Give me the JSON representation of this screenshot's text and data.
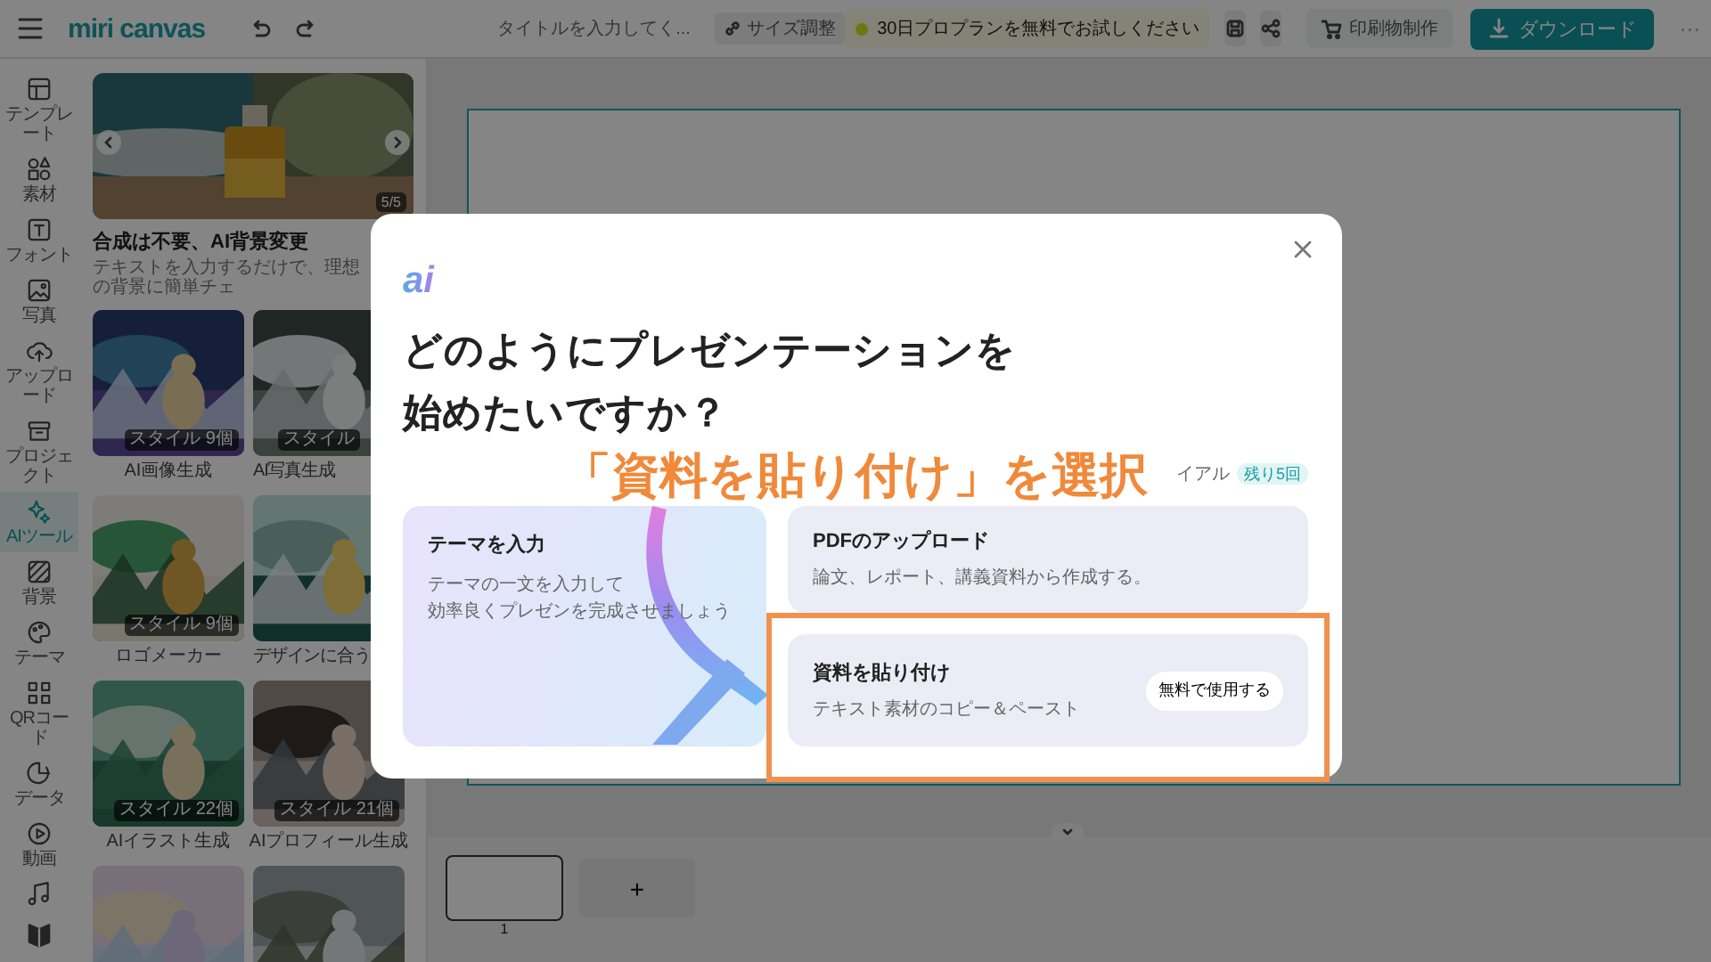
{
  "topbar": {
    "logo": "miri canvas",
    "title_placeholder": "タイトルを入力してく...",
    "resize_button": "サイズ調整",
    "promo": "30日プロプランを無料でお試しください",
    "print_button": "印刷物制作",
    "download_button": "ダウンロード",
    "more": "···"
  },
  "rail": [
    {
      "label": "テンプレート",
      "selected": false
    },
    {
      "label": "素材",
      "selected": false
    },
    {
      "label": "フォント",
      "selected": false
    },
    {
      "label": "写真",
      "selected": false
    },
    {
      "label": "アップロード",
      "selected": false
    },
    {
      "label": "プロジェクト",
      "selected": false
    },
    {
      "label": "AIツール",
      "selected": true
    },
    {
      "label": "背景",
      "selected": false
    },
    {
      "label": "テーマ",
      "selected": false
    },
    {
      "label": "QRコード",
      "selected": false
    },
    {
      "label": "データ",
      "selected": false
    },
    {
      "label": "動画",
      "selected": false
    },
    {
      "selected": false
    },
    {
      "selected": false
    }
  ],
  "panel": {
    "banner": {
      "counter": "5/5",
      "title": "合成は不要、AI背景変更",
      "subtitle": "テキストを入力するだけで、理想の背景に簡単チェ"
    },
    "tiles": [
      {
        "kind": "picture",
        "label": "AI画像生成",
        "badge": "スタイル 9個"
      },
      {
        "kind": "picture",
        "label": "AI写真生成",
        "badge": "スタイル"
      },
      {
        "kind": "picture",
        "label": "ロゴメーカー",
        "badge": "スタイル 9個"
      },
      {
        "kind": "picture",
        "label": "デザインに合う"
      },
      {
        "kind": "picture",
        "label": "AIイラスト生成",
        "badge": "スタイル 22個"
      },
      {
        "kind": "picture",
        "label": "AIプロフィール生成",
        "badge": "スタイル 21個"
      },
      {
        "kind": "picture"
      },
      {
        "kind": "picture"
      }
    ]
  },
  "workspace": {
    "page_number": "1",
    "add_page": "+"
  },
  "modal": {
    "logo": "ai",
    "heading": [
      "どのようにプレゼンテーションを",
      "始めたいですか？"
    ],
    "trial_text": "イアル",
    "trial_badge": "残り5回",
    "options": [
      {
        "kind": "art",
        "title": "テーマを入力",
        "description_lines": [
          "テーマの一文を入力して",
          "効率良くプレゼンを完成させましょう"
        ],
        "highlighted": false
      },
      {
        "kind": "plain",
        "title": "PDFのアップロード",
        "description_lines": [
          "論文、レポート、講義資料から作成する。"
        ],
        "highlighted": false
      },
      {
        "kind": "plain",
        "title": "資料を貼り付け",
        "description_lines": [
          "テキスト素材のコピー＆ペースト"
        ],
        "button": "無料で使用する",
        "highlighted": true
      }
    ]
  },
  "annotation": {
    "callout": "「資料を貼り付け」を選択"
  }
}
